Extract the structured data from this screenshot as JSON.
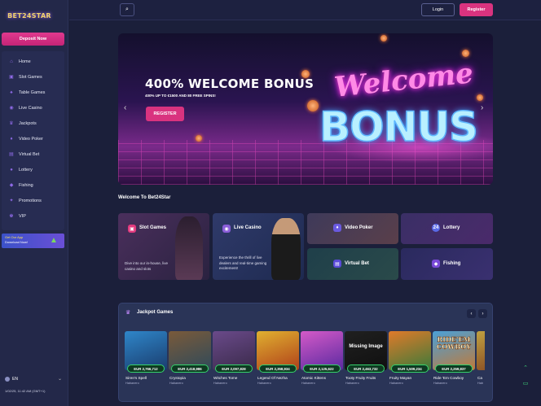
{
  "brand": {
    "logo_text": "BET24STAR"
  },
  "sidebar": {
    "deposit_label": "Deposit Now",
    "items": [
      {
        "label": "Home",
        "icon": "home-icon"
      },
      {
        "label": "Slot Games",
        "icon": "slot-icon"
      },
      {
        "label": "Table Games",
        "icon": "table-icon"
      },
      {
        "label": "Live Casino",
        "icon": "live-icon"
      },
      {
        "label": "Jackpots",
        "icon": "jackpot-icon"
      },
      {
        "label": "Video Poker",
        "icon": "poker-icon"
      },
      {
        "label": "Virtual Bet",
        "icon": "virtual-icon"
      },
      {
        "label": "Lottery",
        "icon": "lottery-icon"
      },
      {
        "label": "Fishing",
        "icon": "fishing-icon"
      },
      {
        "label": "Promotions",
        "icon": "promotions-icon"
      },
      {
        "label": "VIP",
        "icon": "vip-icon"
      }
    ],
    "app_banner": {
      "line1": "Get Our App",
      "line2": "Download Now!"
    },
    "language": "EN",
    "datetime": "1/02/25, 11:42 AM (GMT+1)"
  },
  "header": {
    "login_label": "Login",
    "register_label": "Register"
  },
  "hero": {
    "title": "400% WELCOME BONUS",
    "subtitle": "400% UP TO €1500 AND 80 FREE SPINS!",
    "register_label": "REGISTER",
    "art_word1": "Welcome",
    "art_word2": "BONUS"
  },
  "welcome_heading": "Welcome To Bet24Star",
  "categories": {
    "slot": {
      "label": "Slot Games",
      "desc": "Dive into our in-house, live casino and slots"
    },
    "live": {
      "label": "Live Casino",
      "desc": "Experience the thrill of live dealers and real-time gaming excitement!"
    },
    "video_poker": {
      "label": "Video Poker"
    },
    "lottery": {
      "label": "Lottery",
      "badge": "24"
    },
    "virtual_bet": {
      "label": "Virtual Bet"
    },
    "fishing": {
      "label": "Fishing"
    }
  },
  "jackpot": {
    "title": "Jackpot Games",
    "games": [
      {
        "name": "Siren's Spell",
        "provider": "Habanero",
        "amount": "EUR 2,766,712",
        "c1": "#2f86c9",
        "c2": "#1a3d6e"
      },
      {
        "name": "Crystopia",
        "provider": "Habanero",
        "amount": "EUR 2,418,986",
        "c1": "#7a5a3a",
        "c2": "#2f4a5a"
      },
      {
        "name": "Witches Tome",
        "provider": "Habanero",
        "amount": "EUR 2,097,828",
        "c1": "#6a4a8a",
        "c2": "#3a2a4a"
      },
      {
        "name": "Legend Of Nezha",
        "provider": "Habanero",
        "amount": "EUR 2,358,934",
        "c1": "#e0b030",
        "c2": "#b0401a"
      },
      {
        "name": "Atomic Kittens",
        "provider": "Habanero",
        "amount": "EUR 2,125,622",
        "c1": "#d45ac8",
        "c2": "#5a2aa0"
      },
      {
        "name": "Tooty Fruity Fruits",
        "provider": "Habanero",
        "amount": "EUR 2,463,732",
        "c1": "#202020",
        "c2": "#101010",
        "missing": "Missing Image"
      },
      {
        "name": "Fruity Mayan",
        "provider": "Habanero",
        "amount": "EUR 1,509,234",
        "c1": "#e07a2a",
        "c2": "#3a7a3a"
      },
      {
        "name": "Ride 'Em Cowboy",
        "provider": "Habanero",
        "amount": "EUR 2,259,837",
        "c1": "#4aa0d8",
        "c2": "#c07a3a",
        "art": "RIDE'EM COWBOY"
      },
      {
        "name": "Ca",
        "provider": "Hab",
        "amount": "",
        "c1": "#c0a040",
        "c2": "#804020"
      }
    ]
  },
  "colors": {
    "accent": "#d9337f",
    "bg": "#1b1f3a",
    "sidebar": "#232849",
    "green": "#36d36c"
  }
}
